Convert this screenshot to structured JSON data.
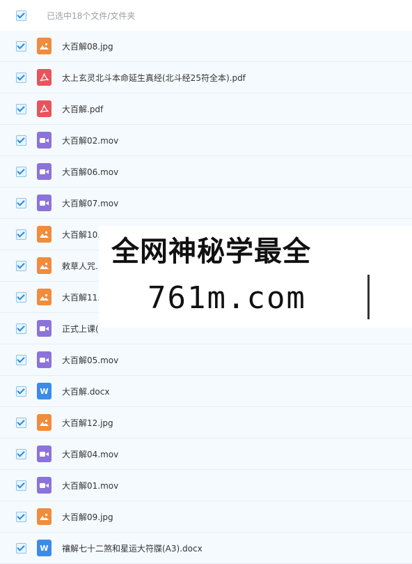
{
  "header": {
    "selection_text": "已选中18个文件/文件夹"
  },
  "files": [
    {
      "name": "大百解08.jpg",
      "type": "image",
      "icon": "image-file-icon"
    },
    {
      "name": "太上玄灵北斗本命延生真经(北斗经25符全本).pdf",
      "type": "pdf",
      "icon": "pdf-file-icon"
    },
    {
      "name": "大百解.pdf",
      "type": "pdf",
      "icon": "pdf-file-icon"
    },
    {
      "name": "大百解02.mov",
      "type": "video",
      "icon": "video-file-icon"
    },
    {
      "name": "大百解06.mov",
      "type": "video",
      "icon": "video-file-icon"
    },
    {
      "name": "大百解07.mov",
      "type": "video",
      "icon": "video-file-icon"
    },
    {
      "name": "大百解10.",
      "type": "image",
      "icon": "image-file-icon"
    },
    {
      "name": "敕草人咒.",
      "type": "image",
      "icon": "image-file-icon"
    },
    {
      "name": "大百解11.",
      "type": "image",
      "icon": "image-file-icon"
    },
    {
      "name": "正式上课(",
      "type": "video",
      "icon": "video-file-icon"
    },
    {
      "name": "大百解05.mov",
      "type": "video",
      "icon": "video-file-icon"
    },
    {
      "name": "大百解.docx",
      "type": "word",
      "icon": "word-file-icon"
    },
    {
      "name": "大百解12.jpg",
      "type": "image",
      "icon": "image-file-icon"
    },
    {
      "name": "大百解04.mov",
      "type": "video",
      "icon": "video-file-icon"
    },
    {
      "name": "大百解01.mov",
      "type": "video",
      "icon": "video-file-icon"
    },
    {
      "name": "大百解09.jpg",
      "type": "image",
      "icon": "image-file-icon"
    },
    {
      "name": "禳解七十二煞和星运大符牒(A3).docx",
      "type": "word",
      "icon": "word-file-icon"
    }
  ],
  "watermark": {
    "line1": "全网神秘学最全",
    "line2": "761m.com"
  },
  "colors": {
    "image": "#f08c3c",
    "pdf": "#e9535b",
    "video": "#8b73d9",
    "word": "#3c8be9",
    "check": "#1f8ee6"
  }
}
